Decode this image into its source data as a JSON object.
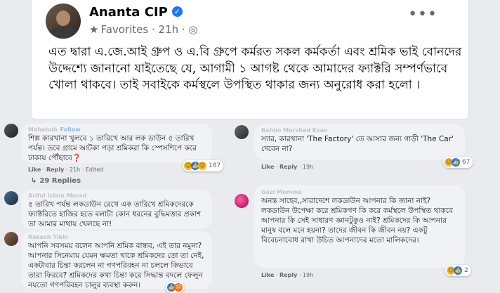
{
  "post": {
    "author": "Ananta CIP",
    "audience": "Favorites",
    "time": "21h",
    "body": "এত দ্বারা এ.জে.আই গ্রুপ ও এ.বি গ্রুপে কর্মরত  সকল কর্মকর্তা এবং শ্রমিক ভাই বোনদের উদ্দেশ্যে জানানো যাইতেছে যে, আগামী ১ আগষ্ট থেকে আমাদের ফ্যাক্টরি সম্পর্ণভাবে খোলা থাকবে। তাই সবাইকে কর্মস্থলে উপস্থিত থাকার জন্য অনুরোধ করা হলো ।"
  },
  "comments": {
    "c1": {
      "name": "Mahabub",
      "follow": "Follow",
      "text": "শিল্প কারখানা খুলবে ১ তারিখে আর লক ডাউন ৫ তারিখ পর্যন্ত। তবে গ্রামে আটকা পড়া শ্রমিকরা কি স্পেসশিপে করে ঢাকায় পৌঁছাবে",
      "qmark": "❓",
      "like": "Like",
      "reply": "Reply",
      "time": "21h",
      "edited": "Edited",
      "reactions": "187",
      "replies": "29 Replies"
    },
    "c2": {
      "name": "Ariful Islam Murad",
      "text": "৫ তারিখ পর্যন্ত লকডাউন রেখে এক তারিখে শ্রমিকদেরকে ফ্যাক্টরিতে হাজির হতে বলাটা কোন ধরনের বুদ্ধিমত্তার প্রকাশ তা আমার মাথায় খেলছে না!"
    },
    "c3": {
      "name": "Rakesh Tikki",
      "text": "আপনি সবসময় বলেন আপনি শ্রমিক বান্ধব, এই তার নমুনা? আপনার সিনেমায় যেমন ক্ষমতা থাকে শ্রমিকদের তো তা নেই, একটাবার চিন্তা করলেন না গণপরিবহন না চললে কিভাবে তারা ফিরবে? শ্রমিকদের কথা চিন্তা করে সিদ্ধান্ত বদলে ফেলুন নয়তো গণপরিবহন চালুর ব্যবস্থা করুন।"
    },
    "c4": {
      "name": "Rahim Morshed Evan",
      "text": "স্যার, কারখানা 'The Factory' তে আসার জন্য গাড়ী 'The Car' দেবেন না?",
      "like": "Like",
      "reply": "Reply",
      "time": "19h",
      "reactions": "67"
    },
    "c5": {
      "name": "Gazi Momina",
      "text": "অনন্ত সাহেব,,সারাদেশে লকডাউন আপনার কি জানা নাই? লকডাউন উপেক্ষা করে শ্রমিকগণ কি করে কর্মস্থলে উপস্থিত থাকবে আপনার কি সেই সাধারণ জ্ঞানটুকুও নাই? শ্রমিকদের কি আপনার মানুষ বলে মনে হয়না? তাদের জীবন কি জীবন নয়? একটু বিবেচনাবোধ রাখা উচিত আপনাদের মতো মালিকদের।",
      "like": "Like",
      "reply": "Reply",
      "time": "19h",
      "reactions": "2"
    }
  },
  "icons": {
    "verified": "verified-check-icon",
    "favorites": "star-icon",
    "more": "more-dots-icon",
    "replies": "reply-arrow-icon"
  },
  "colors": {
    "accent": "#1877f2",
    "bubble": "#f0f2f5",
    "page": "#e9ebee"
  }
}
